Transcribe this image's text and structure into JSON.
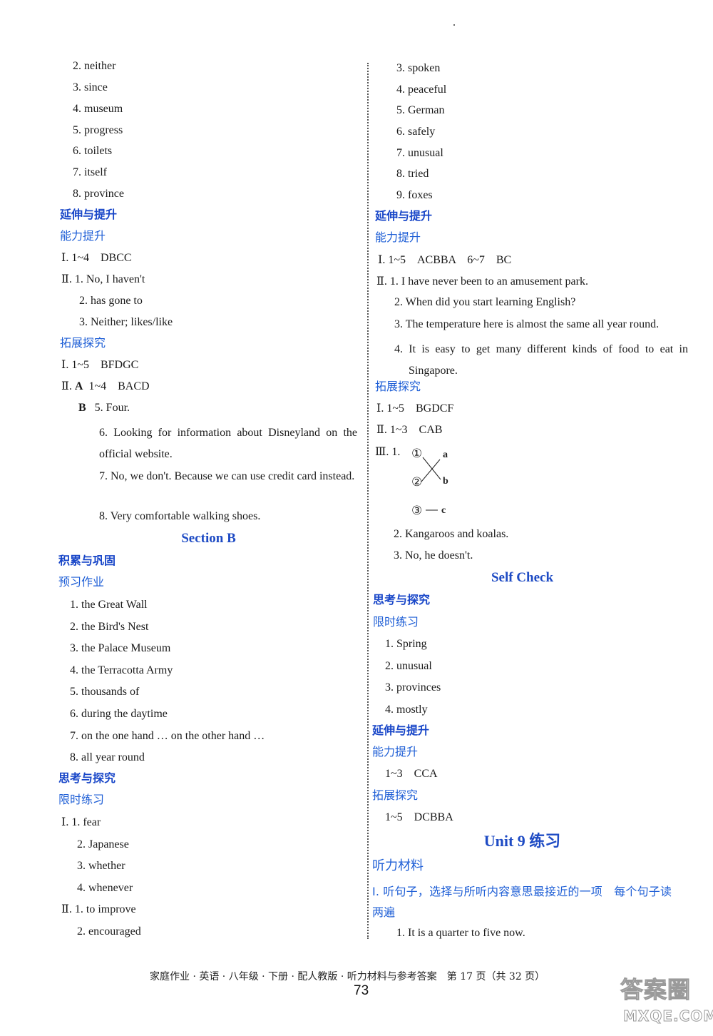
{
  "left": {
    "top_list": [
      "2. neither",
      "3. since",
      "4. museum",
      "5. progress",
      "6. toilets",
      "7. itself",
      "8. province"
    ],
    "ext1": {
      "heading": "延伸与提升",
      "sub1": "能力提升",
      "ability": {
        "i": "Ⅰ. 1~4　DBCC",
        "ii_1": "Ⅱ. 1. No, I haven't",
        "ii_2": "2. has gone to",
        "ii_3": "3. Neither; likes/like"
      },
      "sub2": "拓展探究",
      "explore": {
        "i": "Ⅰ. 1~5　BFDGC",
        "ii_prefix": "Ⅱ.",
        "ii_a_label": "A",
        "ii_a": "1~4　BACD",
        "ii_b_label": "B",
        "b5": "5. Four.",
        "b6": "6. Looking for information about Disneyland on the official website.",
        "b7": "7. No, we don't. Because we can use credit card instead.",
        "b8": "8. Very comfortable walking shoes."
      }
    },
    "section_b": {
      "title": "Section B",
      "heading": "积累与巩固",
      "sub": "预习作业",
      "items": [
        "1. the Great Wall",
        "2. the Bird's Nest",
        "3. the Palace Museum",
        "4. the Terracotta Army",
        "5. thousands of",
        "6. during the daytime",
        "7. on the one hand … on the other hand …",
        "8. all year round"
      ]
    },
    "think": {
      "heading": "思考与探究",
      "sub": "限时练习",
      "i_1": "Ⅰ. 1. fear",
      "i_2": "2. Japanese",
      "i_3": "3. whether",
      "i_4": "4. whenever",
      "ii_1": "Ⅱ. 1. to improve",
      "ii_2": "2. encouraged"
    }
  },
  "right": {
    "top_list": [
      "3. spoken",
      "4. peaceful",
      "5. German",
      "6. safely",
      "7. unusual",
      "8. tried",
      "9. foxes"
    ],
    "ext1": {
      "heading": "延伸与提升",
      "sub1": "能力提升",
      "i": "Ⅰ. 1~5　ACBBA　6~7　BC",
      "ii_1": "Ⅱ. 1. I have never been to an amusement park.",
      "ii_2": "2. When did you start learning English?",
      "ii_3": "3. The temperature here is almost the same all year round.",
      "ii_4": "4. It is easy to get many different kinds of food to eat in Singapore.",
      "sub2": "拓展探究",
      "ex_i": "Ⅰ. 1~5　BGDCF",
      "ex_ii": "Ⅱ. 1~3　CAB",
      "ex_iii_prefix": "Ⅲ. 1.",
      "matching": {
        "left": [
          "①",
          "②",
          "③"
        ],
        "right": [
          "a",
          "b",
          "c"
        ],
        "pairs": [
          [
            "①",
            "b"
          ],
          [
            "②",
            "a"
          ],
          [
            "③",
            "c"
          ]
        ]
      },
      "ex_iii_2": "2. Kangaroos and koalas.",
      "ex_iii_3": "3. No, he doesn't."
    },
    "self_check": {
      "title": "Self Check",
      "heading": "思考与探究",
      "sub": "限时练习",
      "items": [
        "1. Spring",
        "2. unusual",
        "3. provinces",
        "4. mostly"
      ],
      "heading2": "延伸与提升",
      "sub2": "能力提升",
      "ability": "1~3　CCA",
      "sub3": "拓展探究",
      "explore": "1~5　DCBBA"
    },
    "unit9": {
      "title": "Unit 9 练习",
      "heading": "听力材料",
      "question": "Ⅰ. 听句子，选择与所听内容意思最接近的一项　每个句子读两遍",
      "item1": "1. It is a quarter to five now."
    }
  },
  "footer": {
    "text": "家庭作业 · 英语 · 八年级 · 下册 · 配人教版 · 听力材料与参考答案　第 17 页（共 32 页）",
    "page_number": "73"
  },
  "watermark": {
    "cn": "答案圈",
    "url": "MXQE.COM"
  }
}
